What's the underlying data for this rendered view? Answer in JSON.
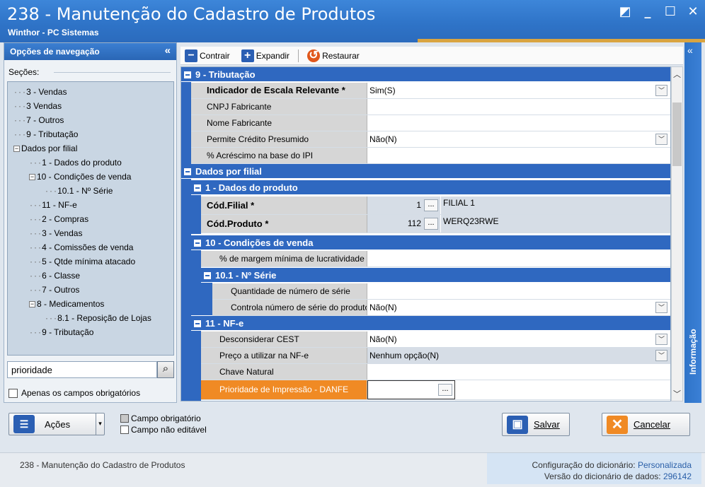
{
  "window": {
    "title": "238 - Manutenção do Cadastro de Produtos",
    "subtitle": "Winthor - PC Sistemas",
    "controls": [
      "◩",
      "_",
      "☐",
      "✕"
    ]
  },
  "nav": {
    "header": "Opções de navegação",
    "collapse_glyph": "«",
    "sections_label": "Seções:",
    "tree": [
      {
        "label": "3 - Vendas",
        "indent": 0,
        "conn": "···"
      },
      {
        "label": "3 Vendas",
        "indent": 0,
        "conn": "···"
      },
      {
        "label": "7 - Outros",
        "indent": 0,
        "conn": "···"
      },
      {
        "label": "9 - Tributação",
        "indent": 0,
        "conn": "···"
      },
      {
        "label": "Dados por filial",
        "indent": 0,
        "conn": "",
        "expander": "−"
      },
      {
        "label": "1 - Dados do produto",
        "indent": 1,
        "conn": "···"
      },
      {
        "label": "10 - Condições de venda",
        "indent": 1,
        "conn": "",
        "expander": "−"
      },
      {
        "label": "10.1 - Nº Série",
        "indent": 2,
        "conn": "···"
      },
      {
        "label": "11 - NF-e",
        "indent": 1,
        "conn": "···"
      },
      {
        "label": "2 - Compras",
        "indent": 1,
        "conn": "···"
      },
      {
        "label": "3 - Vendas",
        "indent": 1,
        "conn": "···"
      },
      {
        "label": "4 - Comissões de venda",
        "indent": 1,
        "conn": "···"
      },
      {
        "label": "5 - Qtde mínima atacado",
        "indent": 1,
        "conn": "···"
      },
      {
        "label": "6 - Classe",
        "indent": 1,
        "conn": "···"
      },
      {
        "label": "7 - Outros",
        "indent": 1,
        "conn": "···"
      },
      {
        "label": "8 - Medicamentos",
        "indent": 1,
        "conn": "",
        "expander": "−"
      },
      {
        "label": "8.1 -  Reposição de Lojas",
        "indent": 2,
        "conn": "···"
      },
      {
        "label": "9 - Tributação",
        "indent": 1,
        "conn": "···"
      }
    ],
    "search_value": "prioridade",
    "search_icon": "magnifier-icon",
    "only_required_label": "Apenas os campos obrigatórios"
  },
  "toolbar": {
    "contrair": "Contrair",
    "expandir": "Expandir",
    "restaurar": "Restaurar"
  },
  "grid": {
    "sec_tributacao": "9 - Tributação",
    "indicador_label": "Indicador de Escala Relevante *",
    "indicador_value": "Sim(S)",
    "cnpj_label": "CNPJ Fabricante",
    "nome_fab_label": "Nome Fabricante",
    "credito_label": "Permite Crédito Presumido",
    "credito_value": "Não(N)",
    "ipi_label": "% Acréscimo na base do IPI",
    "sec_dados_filial": "Dados por filial",
    "sec_dados_produto": "1 - Dados do produto",
    "cod_filial_label": "Cód.Filial *",
    "cod_filial_value": "1",
    "cod_filial_desc": "FILIAL 1",
    "cod_produto_label": "Cód.Produto *",
    "cod_produto_value": "112",
    "cod_produto_desc": "WERQ23RWE",
    "sec_cond_venda": "10 - Condições de venda",
    "margem_label": "% de margem mínima de lucratividade",
    "sec_nserie": "10.1 - Nº Série",
    "qtd_serie_label": "Quantidade de número de série",
    "ctrl_serie_label": "Controla número de série do produto",
    "ctrl_serie_value": "Não(N)",
    "sec_nfe": "11 - NF-e",
    "cest_label": "Desconsiderar CEST",
    "cest_value": "Não(N)",
    "preco_label": "Preço a utilizar na NF-e",
    "preco_value": "Nenhum opção(N)",
    "chave_label": "Chave Natural",
    "prioridade_label": "Prioridade de Impressão - DANFE",
    "prioridade_value": "",
    "ellipsis": "...",
    "dropdown_glyph": "﹀"
  },
  "side_tab": {
    "chevron": "«",
    "label": "Informação"
  },
  "actions": {
    "acoes_label": "Ações",
    "legend_required": "Campo obrigatório",
    "legend_readonly": "Campo não editável",
    "save_label": "Salvar",
    "cancel_label": "Cancelar"
  },
  "status": {
    "left_text": "238 - Manutenção do Cadastro de Produtos",
    "dict_config_label": "Configuração do dicionário:",
    "dict_config_value": "Personalizada",
    "dict_version_label": "Versão do dicionário de dados:",
    "dict_version_value": "296142"
  },
  "colors": {
    "title_blue": "#2f74c8",
    "section_blue": "#2f68c0",
    "active_orange": "#f08a24",
    "label_gray": "#d6d6d6"
  }
}
